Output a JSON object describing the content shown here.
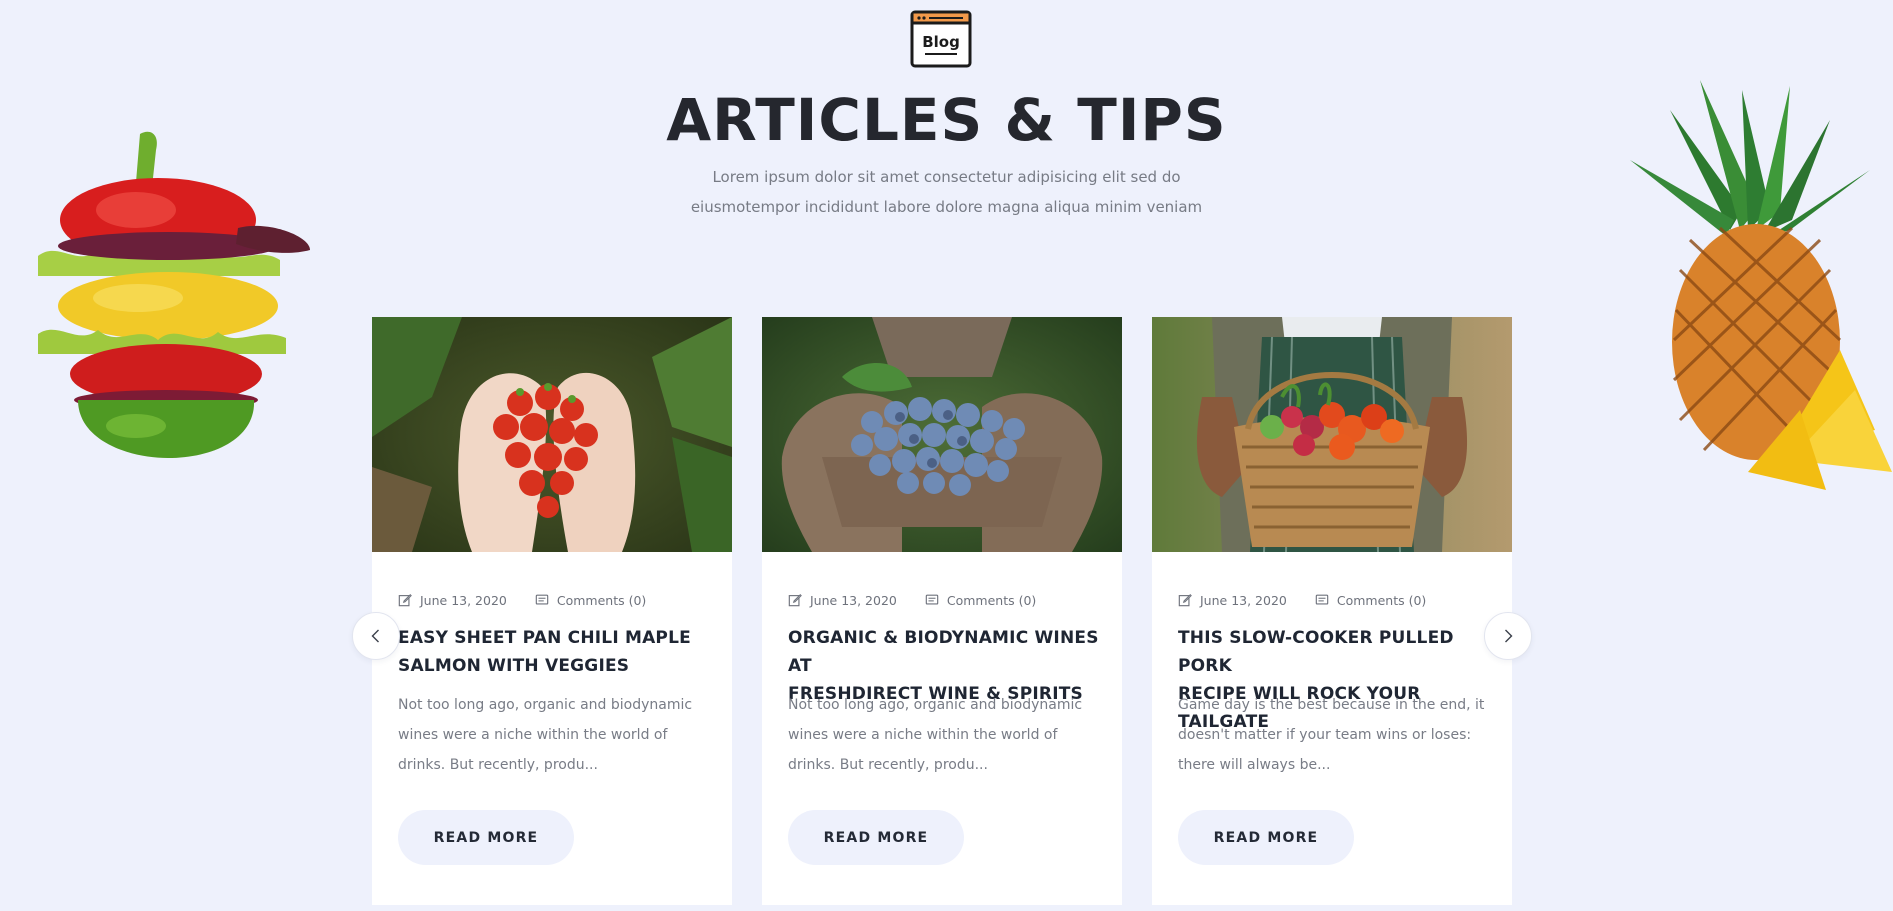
{
  "header": {
    "icon_label": "Blog",
    "title": "ARTICLES & TIPS",
    "subtitle_line1": "Lorem ipsum dolor sit amet consectetur adipisicing elit sed do",
    "subtitle_line2": "eiusmotempor incididunt labore dolore magna aliqua minim veniam"
  },
  "decorations": {
    "left": "stacked-vegetables-image",
    "right": "pineapple-image"
  },
  "posts": [
    {
      "image": "strawberries-in-hands-image",
      "date": "June 13, 2020",
      "comments": "Comments (0)",
      "title_line1": "EASY SHEET PAN CHILI MAPLE",
      "title_line2": "SALMON WITH VEGGIES",
      "excerpt_line1": "Not too long ago, organic and biodynamic",
      "excerpt_line2": "wines were a niche within the world of",
      "excerpt_line3": "drinks. But recently, produ...",
      "button": "READ MORE"
    },
    {
      "image": "grapes-in-hands-image",
      "date": "June 13, 2020",
      "comments": "Comments (0)",
      "title_line1": "ORGANIC & BIODYNAMIC WINES AT",
      "title_line2": "FRESHDIRECT WINE & SPIRITS",
      "excerpt_line1": "Not too long ago, organic and biodynamic",
      "excerpt_line2": "wines were a niche within the world of",
      "excerpt_line3": "drinks. But recently, produ...",
      "button": "READ MORE"
    },
    {
      "image": "vegetable-basket-image",
      "date": "June 13, 2020",
      "comments": "Comments (0)",
      "title_line1": "THIS SLOW-COOKER PULLED PORK",
      "title_line2": "RECIPE WILL ROCK YOUR TAILGATE",
      "excerpt_line1": "Game day is the best because in the end, it",
      "excerpt_line2": "doesn't matter if your team wins or loses:",
      "excerpt_line3": "there will always be...",
      "button": "READ MORE"
    }
  ],
  "carousel": {
    "prev_icon": "chevron-left-icon",
    "next_icon": "chevron-right-icon"
  },
  "colors": {
    "background": "#eef1fc",
    "card": "#ffffff",
    "title": "#25272e",
    "accent_orange": "#f2994a"
  }
}
